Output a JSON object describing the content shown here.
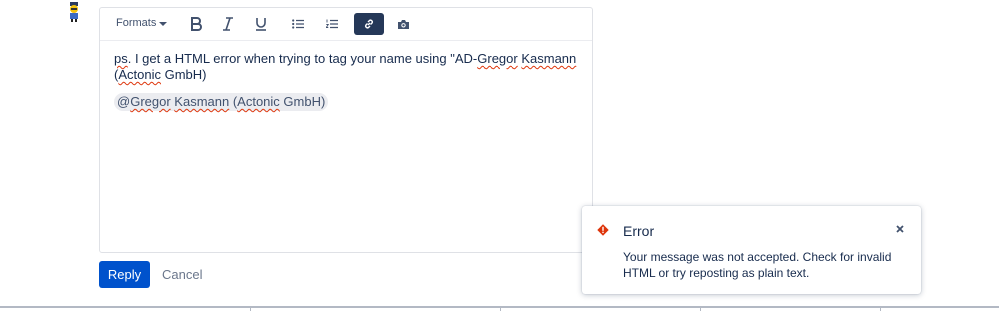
{
  "toolbar": {
    "formats_label": "Formats",
    "buttons": [
      {
        "name": "bold-button",
        "icon": "bold-icon"
      },
      {
        "name": "italic-button",
        "icon": "italic-icon"
      },
      {
        "name": "underline-button",
        "icon": "underline-icon"
      },
      {
        "name": "bullet-list-button",
        "icon": "bullet-list-icon"
      },
      {
        "name": "numbered-list-button",
        "icon": "numbered-list-icon"
      },
      {
        "name": "link-button",
        "icon": "link-icon",
        "active": true
      },
      {
        "name": "image-button",
        "icon": "camera-icon"
      }
    ]
  },
  "editor": {
    "line1_prefix": "ps",
    "line1_middle": ". I get a HTML error when trying to tag your name using \"AD-",
    "line1_word1": "Gregor",
    "line1_space": " ",
    "line1_word2": "Kasmann",
    "line2_open": "(",
    "line2_word": "Actonic",
    "line2_rest": " GmbH)",
    "mention_at": "@",
    "mention_word1": "Gregor",
    "mention_space": " ",
    "mention_word2": "Kasmann",
    "mention_open": " (",
    "mention_word3": "Actonic",
    "mention_rest": " GmbH)"
  },
  "actions": {
    "reply_label": "Reply",
    "cancel_label": "Cancel"
  },
  "toast": {
    "title": "Error",
    "message": "Your message was not accepted. Check for invalid HTML or try reposting as plain text.",
    "icon": "error-icon",
    "close_icon": "close-icon"
  },
  "colors": {
    "primary": "#0052cc",
    "active_toolbar": "#253858",
    "error": "#de350b",
    "text": "#172b4d"
  }
}
